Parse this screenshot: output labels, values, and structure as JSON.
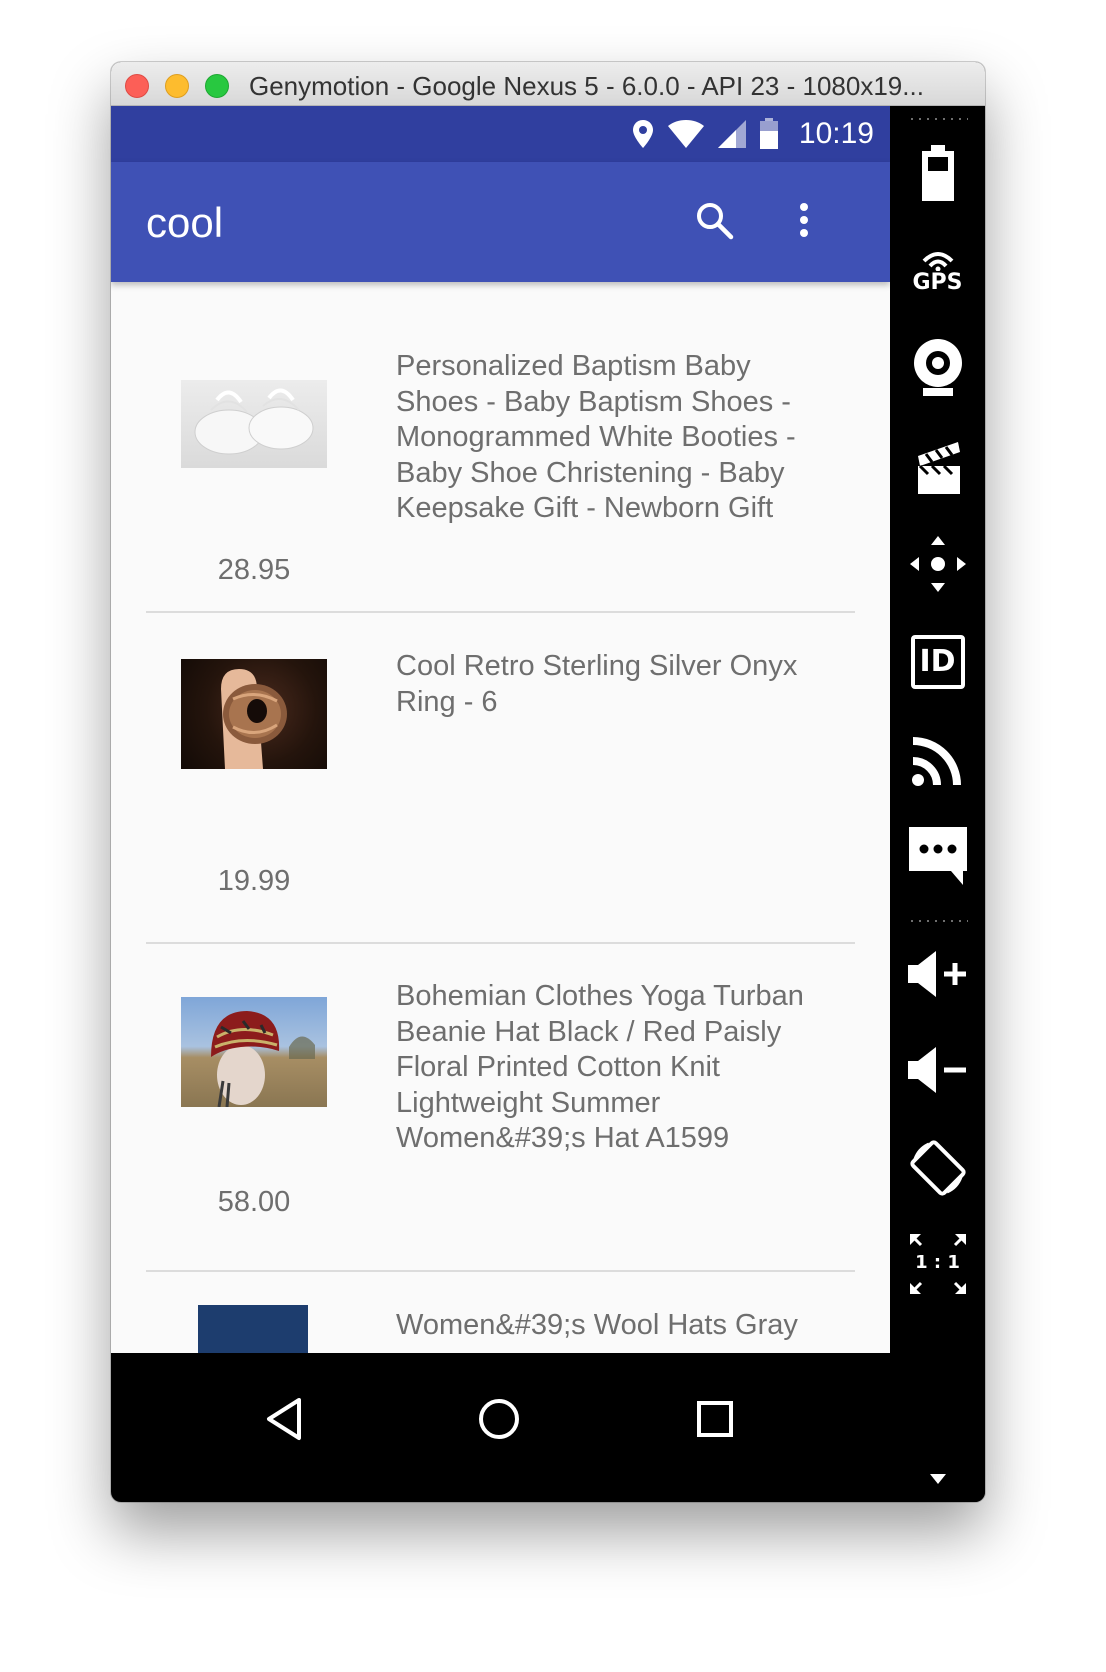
{
  "window": {
    "title": "Genymotion - Google Nexus 5 - 6.0.0 - API 23 - 1080x19..."
  },
  "statusbar": {
    "time": "10:19"
  },
  "appbar": {
    "title": "cool",
    "search_icon": "search-icon",
    "menu_icon": "more-vert-icon"
  },
  "items": [
    {
      "title": "Personalized Baptism Baby Shoes - Baby Baptism Shoes - Monogrammed White Booties - Baby Shoe Christening - Baby Keepsake Gift - Newborn Gift",
      "price": "28.95"
    },
    {
      "title": "Cool Retro Sterling Silver Onyx Ring - 6",
      "price": "19.99"
    },
    {
      "title": "Bohemian Clothes Yoga Turban Beanie Hat Black / Red Paisly Floral Printed Cotton Knit Lightweight Summer Women&#39;s Hat  A1599",
      "price": "58.00"
    },
    {
      "title": "Women&#39;s Wool Hats Gray",
      "price": ""
    }
  ],
  "sidebar": {
    "battery_icon": "battery-icon",
    "gps_label": "GPS",
    "webcam_icon": "webcam-icon",
    "capture_icon": "clapperboard-icon",
    "dpad_icon": "dpad-icon",
    "id_label": "ID",
    "rss_icon": "rss-icon",
    "sms_icon": "sms-icon",
    "volume_up_icon": "volume-up-icon",
    "volume_down_icon": "volume-down-icon",
    "rotate_icon": "rotate-icon",
    "scale_label": "1 : 1"
  }
}
